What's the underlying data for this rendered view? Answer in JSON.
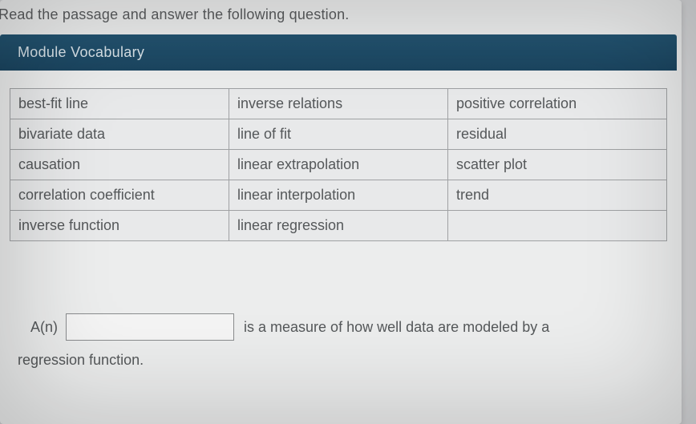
{
  "instruction": "Read the passage and answer the following question.",
  "module_header": "Module Vocabulary",
  "vocab": {
    "rows": [
      {
        "c1": "best-fit line",
        "c2": "inverse relations",
        "c3": "positive correlation"
      },
      {
        "c1": "bivariate data",
        "c2": "line of fit",
        "c3": "residual"
      },
      {
        "c1": "causation",
        "c2": "linear extrapolation",
        "c3": "scatter plot"
      },
      {
        "c1": "correlation coefficient",
        "c2": "linear interpolation",
        "c3": "trend"
      },
      {
        "c1": "inverse function",
        "c2": "linear regression",
        "c3": ""
      }
    ]
  },
  "question": {
    "prefix": "A(n)",
    "input_value": "",
    "after": "is a measure of how well data are modeled by a",
    "line2": "regression function."
  }
}
